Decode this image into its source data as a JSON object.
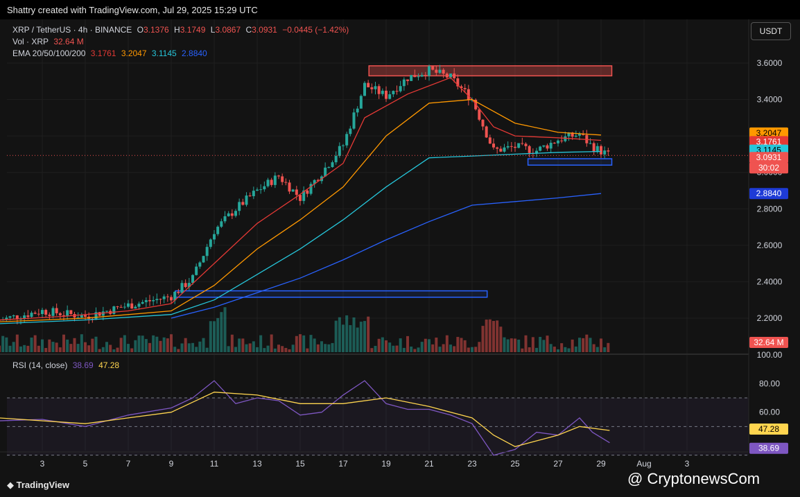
{
  "header": {
    "credit": "Shattry created with TradingView.com, Jul 29, 2025 15:29 UTC"
  },
  "legend": {
    "symbol": "XRP / TetherUS · 4h · BINANCE",
    "o_label": "O",
    "o": "3.1376",
    "h_label": "H",
    "h": "3.1749",
    "l_label": "L",
    "l": "3.0867",
    "c_label": "C",
    "c": "3.0931",
    "change": "−0.0445 (−1.42%)",
    "vol_label": "Vol · XRP",
    "vol": "32.64 M",
    "ema_label": "EMA 20/50/100/200",
    "ema20": "3.1761",
    "ema50": "3.2047",
    "ema100": "3.1145",
    "ema200": "2.8840",
    "rsi_label": "RSI (14, close)",
    "rsi": "38.69",
    "rsi_ma": "47.28"
  },
  "unit_button": "USDT",
  "footer": {
    "logo": "TradingView",
    "watermark": "@ CryptonewsCom"
  },
  "price_axis_labels": [
    "3.6000",
    "3.4000",
    "3.2000",
    "3.0000",
    "2.8000",
    "2.6000",
    "2.4000",
    "2.2000"
  ],
  "rsi_axis_labels": [
    "100.00",
    "80.00",
    "60.00"
  ],
  "badges": {
    "ema50": "3.2047",
    "ema20": "3.1761",
    "ema100": "3.1145",
    "close": "3.0931",
    "countdown": "30:02",
    "ema200": "2.8840",
    "volume": "32.64 M",
    "rsi_ma": "47.28",
    "rsi": "38.69"
  },
  "colors": {
    "bg": "#131313",
    "up": "#26a69a",
    "down": "#ef5350",
    "ema20": "#e53935",
    "ema50": "#ff9800",
    "ema100": "#26c6da",
    "ema200": "#2962ff",
    "rsi": "#7e57c2",
    "rsi_ma": "#ffd54f"
  },
  "chart_data": {
    "type": "line",
    "title": "XRP / TetherUS · 4h · BINANCE",
    "x_ticks": [
      "3",
      "5",
      "7",
      "9",
      "11",
      "13",
      "15",
      "17",
      "19",
      "21",
      "23",
      "25",
      "27",
      "29",
      "Aug",
      "3"
    ],
    "ylim": [
      2.1,
      3.75
    ],
    "series": [
      {
        "name": "EMA 20",
        "points": [
          [
            1,
            2.19
          ],
          [
            4,
            2.21
          ],
          [
            7,
            2.24
          ],
          [
            9,
            2.28
          ],
          [
            11,
            2.5
          ],
          [
            13,
            2.72
          ],
          [
            15,
            2.88
          ],
          [
            17,
            3.05
          ],
          [
            18,
            3.3
          ],
          [
            20,
            3.43
          ],
          [
            22,
            3.52
          ],
          [
            23,
            3.4
          ],
          [
            24,
            3.25
          ],
          [
            25,
            3.2
          ],
          [
            27,
            3.19
          ],
          [
            29,
            3.176
          ]
        ]
      },
      {
        "name": "EMA 50",
        "points": [
          [
            1,
            2.18
          ],
          [
            5,
            2.2
          ],
          [
            9,
            2.24
          ],
          [
            11,
            2.38
          ],
          [
            13,
            2.58
          ],
          [
            15,
            2.74
          ],
          [
            17,
            2.92
          ],
          [
            19,
            3.2
          ],
          [
            21,
            3.38
          ],
          [
            23,
            3.4
          ],
          [
            25,
            3.27
          ],
          [
            27,
            3.22
          ],
          [
            29,
            3.205
          ]
        ]
      },
      {
        "name": "EMA 100",
        "points": [
          [
            1,
            2.17
          ],
          [
            5,
            2.19
          ],
          [
            9,
            2.22
          ],
          [
            11,
            2.3
          ],
          [
            13,
            2.44
          ],
          [
            15,
            2.58
          ],
          [
            17,
            2.74
          ],
          [
            19,
            2.92
          ],
          [
            21,
            3.08
          ],
          [
            23,
            3.09
          ],
          [
            25,
            3.1
          ],
          [
            27,
            3.11
          ],
          [
            29,
            3.115
          ]
        ]
      },
      {
        "name": "EMA 200",
        "points": [
          [
            9,
            2.2
          ],
          [
            11,
            2.26
          ],
          [
            13,
            2.34
          ],
          [
            15,
            2.42
          ],
          [
            17,
            2.52
          ],
          [
            19,
            2.63
          ],
          [
            21,
            2.73
          ],
          [
            23,
            2.82
          ],
          [
            25,
            2.84
          ],
          [
            27,
            2.86
          ],
          [
            29,
            2.884
          ]
        ]
      }
    ],
    "zones": [
      {
        "from_day": 18.2,
        "to_day": 29.5,
        "low": 3.53,
        "high": 3.585,
        "color": "#ef5350"
      },
      {
        "from_day": 25.6,
        "to_day": 29.5,
        "low": 3.04,
        "high": 3.075,
        "color": "#2962ff"
      },
      {
        "from_day": 9.2,
        "to_day": 23.7,
        "low": 2.315,
        "high": 2.35,
        "color": "#2962ff"
      }
    ],
    "last_close": 3.0931,
    "rsi": {
      "ylim": [
        20,
        100
      ],
      "levels": [
        70,
        50,
        30
      ],
      "last": 38.69,
      "ma_last": 47.28,
      "points": [
        [
          1,
          54
        ],
        [
          3,
          55
        ],
        [
          5,
          50
        ],
        [
          7,
          58
        ],
        [
          9,
          63
        ],
        [
          10,
          70
        ],
        [
          11,
          82
        ],
        [
          12,
          66
        ],
        [
          13,
          70
        ],
        [
          14,
          68
        ],
        [
          15,
          58
        ],
        [
          16,
          60
        ],
        [
          17,
          72
        ],
        [
          18,
          82
        ],
        [
          19,
          66
        ],
        [
          20,
          62
        ],
        [
          21,
          62
        ],
        [
          22,
          58
        ],
        [
          23,
          52
        ],
        [
          24,
          30
        ],
        [
          25,
          34
        ],
        [
          26,
          46
        ],
        [
          27,
          44
        ],
        [
          28,
          56
        ],
        [
          28.6,
          46
        ],
        [
          29.4,
          38.69
        ]
      ],
      "ma_points": [
        [
          1,
          56
        ],
        [
          5,
          52
        ],
        [
          7,
          56
        ],
        [
          9,
          60
        ],
        [
          11,
          74
        ],
        [
          13,
          72
        ],
        [
          15,
          66
        ],
        [
          17,
          66
        ],
        [
          19,
          70
        ],
        [
          21,
          64
        ],
        [
          23,
          56
        ],
        [
          24,
          44
        ],
        [
          25,
          36
        ],
        [
          27,
          44
        ],
        [
          28,
          50
        ],
        [
          29.4,
          47.28
        ]
      ]
    },
    "volume_last": "32.64 M"
  }
}
